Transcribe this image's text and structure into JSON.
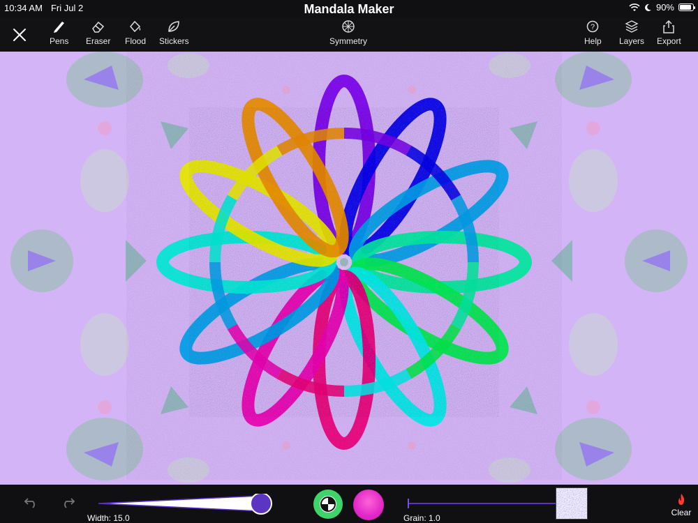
{
  "status": {
    "time": "10:34 AM",
    "date": "Fri Jul 2",
    "battery_percent": "90%",
    "battery_level": 0.9,
    "icons": [
      "wifi-icon",
      "moon-icon",
      "battery-icon"
    ]
  },
  "app": {
    "title": "Mandala Maker"
  },
  "toolbar": {
    "pens": "Pens",
    "eraser": "Eraser",
    "flood": "Flood",
    "stickers": "Stickers",
    "symmetry": "Symmetry",
    "help": "Help",
    "layers": "Layers",
    "export": "Export"
  },
  "bottom": {
    "width_label": "Width: 15.0",
    "grain_label": "Grain: 1.0",
    "clear": "Clear",
    "width_value": 15.0,
    "grain_value": 1.0
  },
  "colors": {
    "canvas_bg": "#d3b4f7",
    "accent": "#5b2fd0",
    "slider_thumb": "#5c35c2",
    "swap_button": "#3fd46a",
    "current_color": "#e227c8",
    "clear_icon": "#ff3b30"
  }
}
